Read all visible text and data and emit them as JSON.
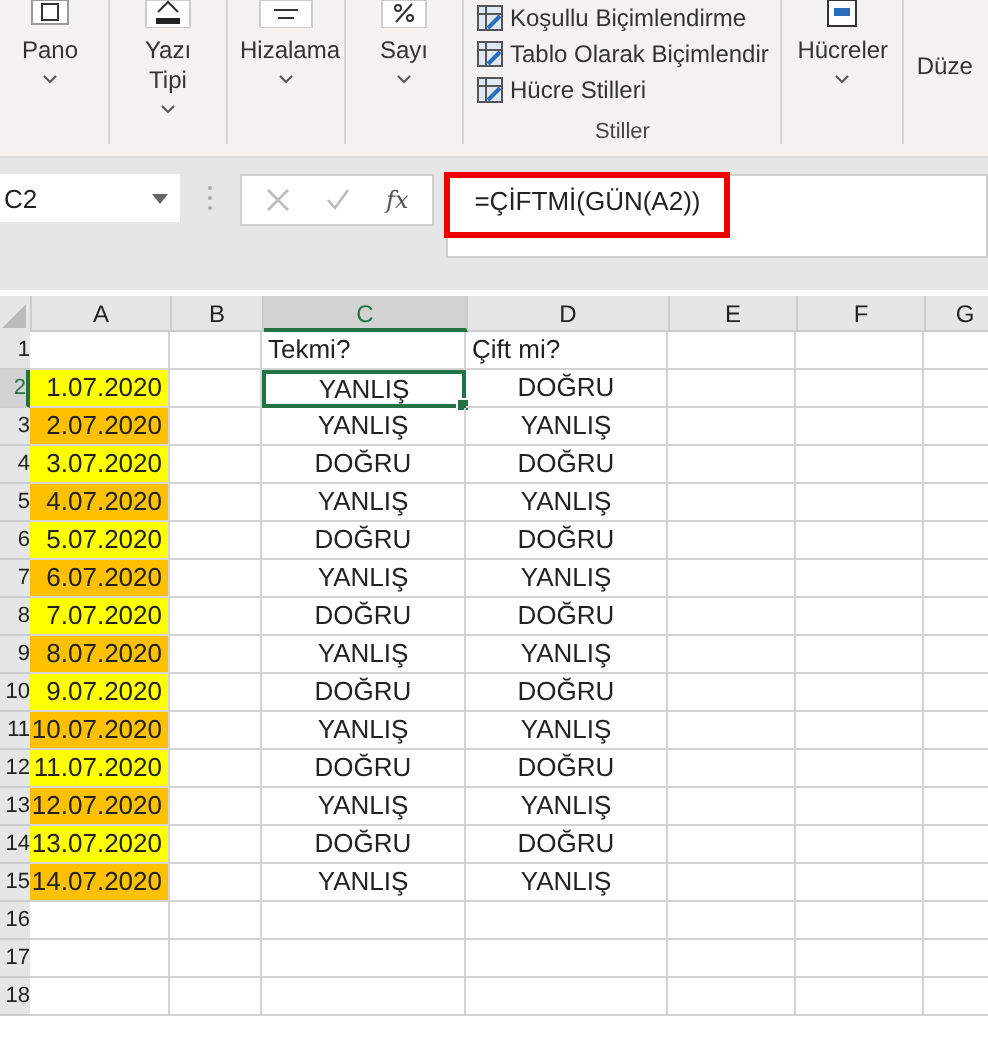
{
  "ribbon": {
    "groups": [
      {
        "label": "Pano",
        "kind": "clipboard"
      },
      {
        "label": "Yazı\nTipi",
        "kind": "font"
      },
      {
        "label": "Hizalama",
        "kind": "align"
      },
      {
        "label": "Sayı",
        "kind": "number"
      }
    ],
    "styles": {
      "items": [
        "Koşullu Biçimlendirme",
        "Tablo Olarak Biçimlendir",
        "Hücre Stilleri"
      ],
      "label": "Stiller"
    },
    "cells_group": {
      "label": "Hücreler"
    },
    "edit_group": {
      "label": "Düze"
    }
  },
  "formula_bar": {
    "name_box": "C2",
    "function_label": "fx",
    "formula": "=ÇİFTMİ(GÜN(A2))"
  },
  "sheet": {
    "columns": [
      {
        "label": "A",
        "selected": false
      },
      {
        "label": "B",
        "selected": false
      },
      {
        "label": "C",
        "selected": true
      },
      {
        "label": "D",
        "selected": false
      },
      {
        "label": "E",
        "selected": false
      },
      {
        "label": "F",
        "selected": false
      },
      {
        "label": "G",
        "selected": false
      }
    ],
    "rows": [
      {
        "number": "1",
        "kind": "header",
        "a": "",
        "c": "Tekmi?",
        "d": "Çift mi?",
        "selected": false
      },
      {
        "number": "2",
        "kind": "value",
        "a": "1.07.2020",
        "color": "#ffff00",
        "c": "YANLIŞ",
        "d": "DOĞRU",
        "selected": true
      },
      {
        "number": "3",
        "kind": "value",
        "a": "2.07.2020",
        "color": "#ffc000",
        "c": "YANLIŞ",
        "d": "YANLIŞ",
        "selected": false
      },
      {
        "number": "4",
        "kind": "value",
        "a": "3.07.2020",
        "color": "#ffff00",
        "c": "DOĞRU",
        "d": "DOĞRU",
        "selected": false
      },
      {
        "number": "5",
        "kind": "value",
        "a": "4.07.2020",
        "color": "#ffc000",
        "c": "YANLIŞ",
        "d": "YANLIŞ",
        "selected": false
      },
      {
        "number": "6",
        "kind": "value",
        "a": "5.07.2020",
        "color": "#ffff00",
        "c": "DOĞRU",
        "d": "DOĞRU",
        "selected": false
      },
      {
        "number": "7",
        "kind": "value",
        "a": "6.07.2020",
        "color": "#ffc000",
        "c": "YANLIŞ",
        "d": "YANLIŞ",
        "selected": false
      },
      {
        "number": "8",
        "kind": "value",
        "a": "7.07.2020",
        "color": "#ffff00",
        "c": "DOĞRU",
        "d": "DOĞRU",
        "selected": false
      },
      {
        "number": "9",
        "kind": "value",
        "a": "8.07.2020",
        "color": "#ffc000",
        "c": "YANLIŞ",
        "d": "YANLIŞ",
        "selected": false
      },
      {
        "number": "10",
        "kind": "value",
        "a": "9.07.2020",
        "color": "#ffff00",
        "c": "DOĞRU",
        "d": "DOĞRU",
        "selected": false
      },
      {
        "number": "11",
        "kind": "value",
        "a": "10.07.2020",
        "color": "#ffc000",
        "c": "YANLIŞ",
        "d": "YANLIŞ",
        "selected": false
      },
      {
        "number": "12",
        "kind": "value",
        "a": "11.07.2020",
        "color": "#ffff00",
        "c": "DOĞRU",
        "d": "DOĞRU",
        "selected": false
      },
      {
        "number": "13",
        "kind": "value",
        "a": "12.07.2020",
        "color": "#ffc000",
        "c": "YANLIŞ",
        "d": "YANLIŞ",
        "selected": false
      },
      {
        "number": "14",
        "kind": "value",
        "a": "13.07.2020",
        "color": "#ffff00",
        "c": "DOĞRU",
        "d": "DOĞRU",
        "selected": false
      },
      {
        "number": "15",
        "kind": "value",
        "a": "14.07.2020",
        "color": "#ffc000",
        "c": "YANLIŞ",
        "d": "YANLIŞ",
        "selected": false
      },
      {
        "number": "16",
        "kind": "empty",
        "selected": false
      },
      {
        "number": "17",
        "kind": "empty",
        "selected": false
      },
      {
        "number": "18",
        "kind": "empty",
        "selected": false
      }
    ]
  }
}
